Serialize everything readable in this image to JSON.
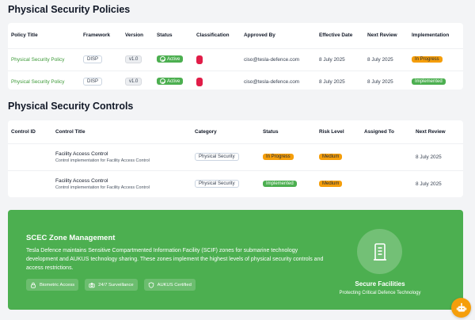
{
  "policies": {
    "title": "Physical Security Policies",
    "columns": [
      "Policy Title",
      "Framework",
      "Version",
      "Status",
      "Classification",
      "Approved By",
      "Effective Date",
      "Next Review",
      "Implementation"
    ],
    "rows": [
      {
        "title": "Physical Security Policy",
        "framework": "DISP",
        "version": "v1.0",
        "status": "Active",
        "approved_by": "ciso@tesla-defence.com",
        "effective_date": "8 July 2025",
        "next_review": "8 July 2025",
        "implementation": "In Progress"
      },
      {
        "title": "Physical Security Policy",
        "framework": "DISP",
        "version": "v1.0",
        "status": "Active",
        "approved_by": "ciso@tesla-defence.com",
        "effective_date": "8 July 2025",
        "next_review": "8 July 2025",
        "implementation": "Implemented"
      }
    ]
  },
  "controls": {
    "title": "Physical Security Controls",
    "columns": [
      "Control ID",
      "Control Title",
      "Category",
      "Status",
      "Risk Level",
      "Assigned To",
      "Next Review"
    ],
    "rows": [
      {
        "id": "",
        "title": "Facility Access Control",
        "subtitle": "Control implementation for Facility Access Control",
        "category": "Physical Security",
        "status": "In Progress",
        "risk": "Medium",
        "assigned": "",
        "next_review": "8 July 2025"
      },
      {
        "id": "",
        "title": "Facility Access Control",
        "subtitle": "Control implementation for Facility Access Control",
        "category": "Physical Security",
        "status": "Implemented",
        "risk": "Medium",
        "assigned": "",
        "next_review": "8 July 2025"
      }
    ]
  },
  "scec": {
    "title": "SCEC Zone Management",
    "description": "Tesla Defence maintains Sensitive Compartmented Information Facility (SCIF) zones for submarine technology development and AUKUS technology sharing. These zones implement the highest levels of physical security controls and access restrictions.",
    "pills": [
      {
        "label": "Biometric Access",
        "icon": "fingerprint-icon"
      },
      {
        "label": "24/7 Surveillance",
        "icon": "camera-icon"
      },
      {
        "label": "AUKUS Certified",
        "icon": "shield-icon"
      }
    ],
    "facility_title": "Secure Facilities",
    "facility_subtitle": "Protecting Critical Defence Technology"
  },
  "colors": {
    "accent_green": "#4caf50",
    "warning_orange": "#f59e0b",
    "classification_red": "#e11d48",
    "link_green": "#3d9a38"
  }
}
